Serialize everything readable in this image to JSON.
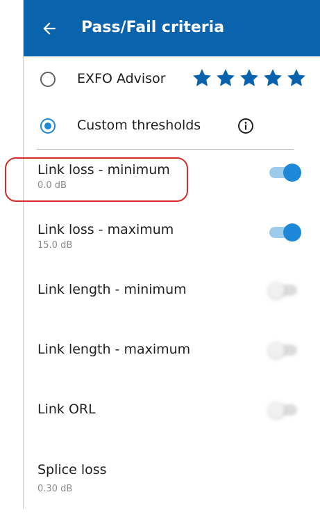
{
  "header": {
    "title": "Pass/Fail criteria",
    "background_color": "#0a63ad"
  },
  "options": [
    {
      "label": "EXFO Advisor",
      "selected": false,
      "rating_stars": 5,
      "icon": "star-icon"
    },
    {
      "label": "Custom thresholds",
      "selected": true,
      "icon": "info-icon"
    }
  ],
  "settings": [
    {
      "title": "Link loss - minimum",
      "value": "0.0 dB",
      "enabled": true
    },
    {
      "title": "Link loss - maximum",
      "value": "15.0 dB",
      "enabled": true
    },
    {
      "title": "Link length - minimum",
      "value": "",
      "enabled": false
    },
    {
      "title": "Link length - maximum",
      "value": "",
      "enabled": false
    },
    {
      "title": "Link ORL",
      "value": "",
      "enabled": false
    },
    {
      "title": "Splice loss",
      "value": "0.30 dB",
      "enabled": false
    }
  ],
  "colors": {
    "accent": "#1e88d8",
    "star": "#0a63ad",
    "highlight": "#d62b2b"
  }
}
